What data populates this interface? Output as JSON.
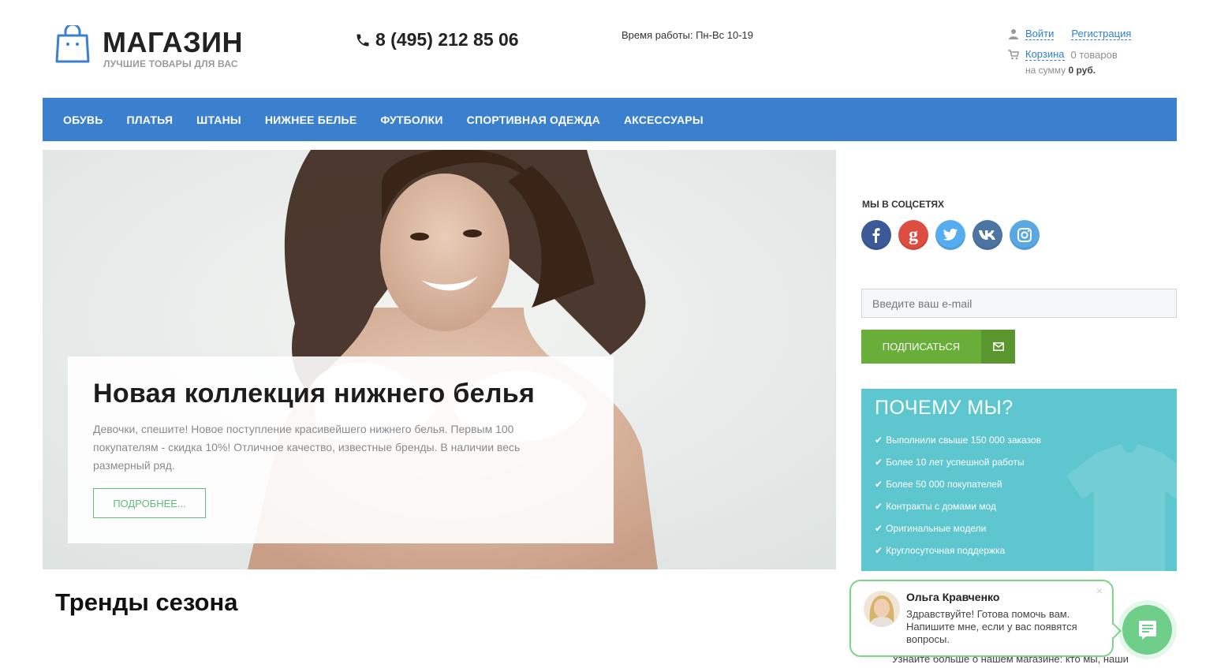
{
  "header": {
    "logo_title": "МАГАЗИН",
    "logo_subtitle": "ЛУЧШИЕ ТОВАРЫ ДЛЯ ВАС",
    "phone": "8 (495) 212 85 06",
    "hours": "Время работы: Пн-Вс 10-19",
    "login_label": "Войти",
    "register_label": "Регистрация",
    "cart_label": "Корзина",
    "cart_count": "0 товаров",
    "cart_sum_prefix": "на сумму",
    "cart_sum_value": "0 руб."
  },
  "nav": {
    "items": [
      {
        "label": "ОБУВЬ"
      },
      {
        "label": "ПЛАТЬЯ"
      },
      {
        "label": "ШТАНЫ"
      },
      {
        "label": "НИЖНЕЕ БЕЛЬЕ"
      },
      {
        "label": "ФУТБОЛКИ"
      },
      {
        "label": "СПОРТИВНАЯ ОДЕЖДА"
      },
      {
        "label": "АКСЕССУАРЫ"
      }
    ]
  },
  "hero": {
    "title": "Новая коллекция нижнего белья",
    "text": "Девочки, спешите! Новое поступление красивейшего нижнего белья. Первым 100 покупателям - скидка 10%! Отличное качество, известные бренды. В наличии весь размерный ряд.",
    "button_label": "ПОДРОБНЕЕ..."
  },
  "sidebar": {
    "social_title": "МЫ В СОЦСЕТЯХ",
    "social": [
      {
        "name": "facebook-icon",
        "glyph": "f",
        "color": "#3d5a98"
      },
      {
        "name": "google-plus-icon",
        "glyph": "g",
        "color": "#dc4e41"
      },
      {
        "name": "twitter-icon",
        "glyph": "t",
        "color": "#55acee"
      },
      {
        "name": "vk-icon",
        "glyph": "vk",
        "color": "#4c75a3"
      },
      {
        "name": "instagram-icon",
        "glyph": "ig",
        "color": "#59a7e3"
      }
    ],
    "email_placeholder": "Введите ваш e-mail",
    "subscribe_label": "ПОДПИСАТЬСЯ",
    "why_title": "ПОЧЕМУ МЫ?",
    "why_items": [
      {
        "label": "Выполнили свыше 150 000 заказов"
      },
      {
        "label": "Более 10 лет успешной работы"
      },
      {
        "label": "Более 50 000 покупателей"
      },
      {
        "label": "Контракты с домами мод"
      },
      {
        "label": "Оригинальные модели"
      },
      {
        "label": "Круглосуточная поддержка"
      }
    ]
  },
  "trends_title": "Тренды сезона",
  "below_text": "Узнайте больше о нашем магазине: кто мы, наши",
  "chat": {
    "name": "Ольга Кравченко",
    "message": "Здравствуйте! Готова помочь вам. Напишите мне, если у вас появятся вопросы.",
    "close_glyph": "×"
  },
  "colors": {
    "nav_bg": "#3b80cf",
    "accent_green": "#6aae3a",
    "why_bg": "#5ec6cf",
    "chat_border": "#7ed58a",
    "link_blue": "#2f7fd2"
  }
}
